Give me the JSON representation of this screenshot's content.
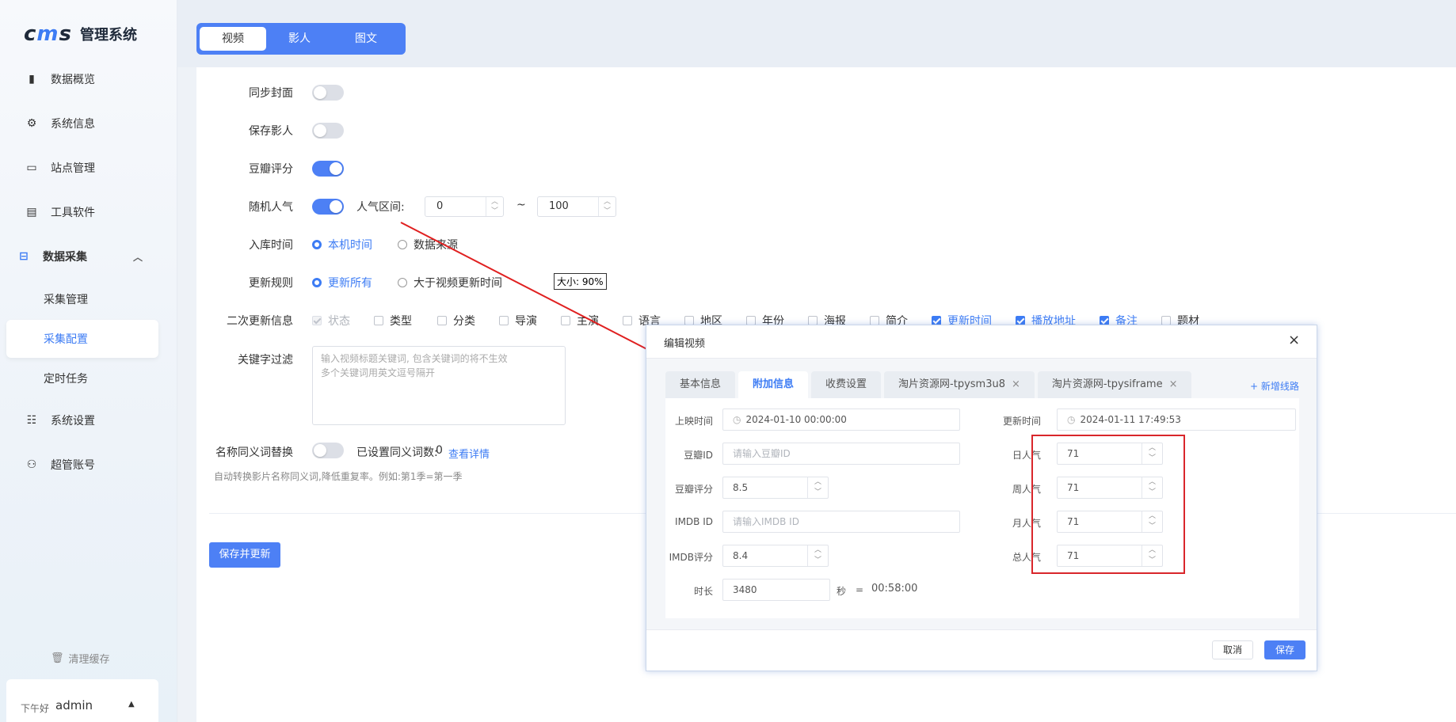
{
  "sidebar": {
    "logo_text_left": "c",
    "logo_text_mid": "m",
    "logo_text_right": "s",
    "title": "管理系统",
    "items": [
      {
        "label": "数据概览",
        "icon": "bar-chart-icon"
      },
      {
        "label": "系统信息",
        "icon": "chip-icon"
      },
      {
        "label": "站点管理",
        "icon": "monitor-icon"
      },
      {
        "label": "工具软件",
        "icon": "window-icon"
      },
      {
        "label": "数据采集",
        "icon": "collect-icon"
      },
      {
        "label": "系统设置",
        "icon": "settings-icon"
      },
      {
        "label": "超管账号",
        "icon": "user-icon"
      }
    ],
    "sub_items": [
      "采集管理",
      "采集配置",
      "定时任务"
    ],
    "clear_cache": "清理缓存",
    "greeting": "下午好",
    "username": "admin"
  },
  "tabs": [
    "视频",
    "影人",
    "图文"
  ],
  "form": {
    "sync_cover": "同步封面",
    "save_actor": "保存影人",
    "douban_score": "豆瓣评分",
    "random_pop": "随机人气",
    "pop_range_label": "人气区间:",
    "pop_min": "0",
    "pop_tilde": "~",
    "pop_max": "100",
    "in_time_label": "入库时间",
    "in_time_options": [
      "本机时间",
      "数据来源"
    ],
    "update_rule_label": "更新规则",
    "update_rule_options": [
      "更新所有",
      "大于视频更新时间"
    ],
    "size_tooltip": "大小: 90%",
    "second_update_label": "二次更新信息",
    "second_update_options": [
      "状态",
      "类型",
      "分类",
      "导演",
      "主演",
      "语言",
      "地区",
      "年份",
      "海报",
      "简介",
      "更新时间",
      "播放地址",
      "备注",
      "题材"
    ],
    "keyword_filter_label": "关键字过滤",
    "keyword_placeholder": "输入视频标题关键词, 包含关键词的将不生效\n多个关键词用英文逗号隔开",
    "synonym_label": "名称同义词替换",
    "synonym_count_label": "已设置同义词数:",
    "synonym_count": "0",
    "synonym_link": "查看详情",
    "synonym_hint": "自动转换影片名称同义词,降低重复率。例如:第1季=第一季",
    "save_button": "保存并更新"
  },
  "dialog": {
    "title": "编辑视频",
    "tabs": [
      "基本信息",
      "附加信息",
      "收费设置",
      "淘片资源网-tpysm3u8",
      "淘片资源网-tpysiframe"
    ],
    "add_route": "+ 新增线路",
    "release_time_label": "上映时间",
    "release_time": "2024-01-10 00:00:00",
    "update_time_label": "更新时间",
    "update_time": "2024-01-11 17:49:53",
    "douban_id_label": "豆瓣ID",
    "douban_id_placeholder": "请输入豆瓣ID",
    "douban_score_label": "豆瓣评分",
    "douban_score": "8.5",
    "imdb_id_label": "IMDB ID",
    "imdb_id_placeholder": "请输入IMDB ID",
    "imdb_score_label": "IMDB评分",
    "imdb_score": "8.4",
    "duration_label": "时长",
    "duration": "3480",
    "duration_unit": "秒",
    "duration_eq": "=",
    "duration_fmt": "00:58:00",
    "day_pop_label": "日人气",
    "day_pop": "71",
    "week_pop_label": "周人气",
    "week_pop": "71",
    "month_pop_label": "月人气",
    "month_pop": "71",
    "total_pop_label": "总人气",
    "total_pop": "71",
    "cancel": "取消",
    "save": "保存"
  }
}
